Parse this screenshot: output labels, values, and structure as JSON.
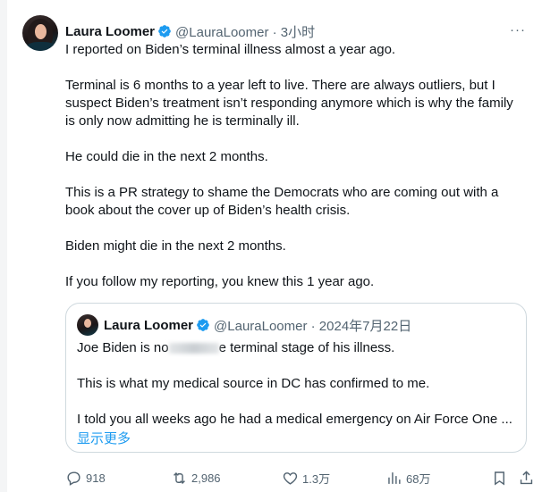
{
  "tweet": {
    "author_name": "Laura Loomer",
    "handle_time": "@LauraLoomer · 3小时",
    "more": "···",
    "paragraphs": [
      "I reported on Biden’s terminal illness almost a year ago.",
      "Terminal is 6 months to a year left to live. There are always outliers, but I suspect Biden’s treatment isn’t responding anymore which is why the family is only now admitting he is terminally ill.",
      "He could die in the next 2 months.",
      "This is a PR strategy to shame the Democrats who are coming out with a book about the cover up of Biden’s health crisis.",
      "Biden might die in the next 2 months.",
      "If you follow my reporting, you knew this 1 year ago."
    ]
  },
  "quote": {
    "author_name": "Laura Loomer",
    "handle_date": "@LauraLoomer · 2024年7月22日",
    "line1_start": "Joe Biden is no",
    "line1_end": "e terminal stage of his illness.",
    "line2": "This is what my medical source in DC has confirmed to me.",
    "line3": "I told you all weeks ago he had a medical emergency on Air Force One ...",
    "show_more": "显示更多"
  },
  "actions": {
    "replies": "918",
    "reposts": "2,986",
    "likes": "1.3万",
    "views": "68万"
  },
  "colors": {
    "accent": "#1d9bf0",
    "muted": "#536471",
    "text": "#0f1419",
    "border": "#cfd9de"
  }
}
